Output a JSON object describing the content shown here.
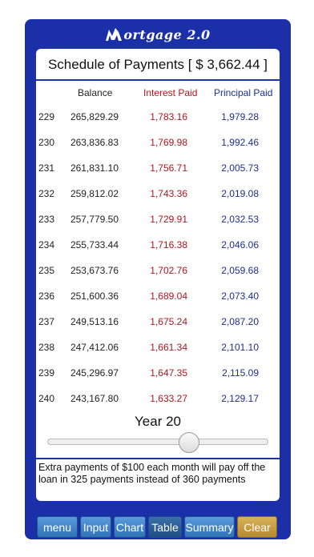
{
  "app": {
    "title": "ortgage 2.0",
    "logo_letter": "M"
  },
  "schedule": {
    "title": "Schedule of Payments [ $ 3,662.44 ]",
    "columns": {
      "balance": "Balance",
      "interest": "Interest Paid",
      "principal": "Principal Paid"
    },
    "rows": [
      {
        "n": "229",
        "balance": "265,829.29",
        "interest": "1,783.16",
        "principal": "1,979.28"
      },
      {
        "n": "230",
        "balance": "263,836.83",
        "interest": "1,769.98",
        "principal": "1,992.46"
      },
      {
        "n": "231",
        "balance": "261,831.10",
        "interest": "1,756.71",
        "principal": "2,005.73"
      },
      {
        "n": "232",
        "balance": "259,812.02",
        "interest": "1,743.36",
        "principal": "2,019.08"
      },
      {
        "n": "233",
        "balance": "257,779.50",
        "interest": "1,729.91",
        "principal": "2,032.53"
      },
      {
        "n": "234",
        "balance": "255,733.44",
        "interest": "1,716.38",
        "principal": "2,046.06"
      },
      {
        "n": "235",
        "balance": "253,673.76",
        "interest": "1,702.76",
        "principal": "2,059.68"
      },
      {
        "n": "236",
        "balance": "251,600.36",
        "interest": "1,689.04",
        "principal": "2,073.40"
      },
      {
        "n": "237",
        "balance": "249,513.16",
        "interest": "1,675.24",
        "principal": "2,087.20"
      },
      {
        "n": "238",
        "balance": "247,412.06",
        "interest": "1,661.34",
        "principal": "2,101.10"
      },
      {
        "n": "239",
        "balance": "245,296.97",
        "interest": "1,647.35",
        "principal": "2,115.09"
      },
      {
        "n": "240",
        "balance": "243,167.80",
        "interest": "1,633.27",
        "principal": "2,129.17"
      }
    ]
  },
  "year": {
    "label": "Year 20",
    "slider_fraction": 0.64
  },
  "info": {
    "text": "Extra payments of $100 each month will pay off the loan in 325 payments instead of 360 payments"
  },
  "nav": {
    "menu": "menu",
    "input": "Input",
    "chart": "Chart",
    "table": "Table",
    "summary": "Summary",
    "clear": "Clear"
  },
  "colors": {
    "frame": "#1b2fa8",
    "interest": "#b0161b",
    "principal": "#1b2f8f",
    "clear_button": "#c9a04a",
    "nav_button": "#3f86c9"
  }
}
